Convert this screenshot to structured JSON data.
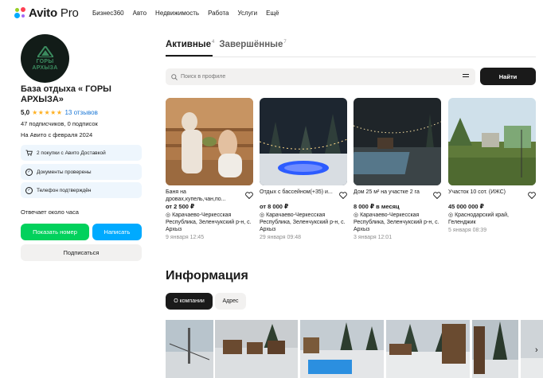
{
  "header": {
    "logo_text": "Avito",
    "logo_suffix": "Pro",
    "nav": [
      "Бизнес360",
      "Авто",
      "Недвижимость",
      "Работа",
      "Услуги",
      "Ещё"
    ]
  },
  "profile": {
    "avatar_text": "ГОРЫ\nАРХЫЗА",
    "name": "База отдыха « ГОРЫ АРХЫЗА»",
    "rating": "5,0",
    "stars": "★★★★★",
    "reviews": "13 отзывов",
    "subscribers": "47 подписчиков, 0 подписок",
    "since": "На Авито с февраля 2024",
    "badges": [
      "2 покупки с Авито Доставкой",
      "Документы проверены",
      "Телефон подтверждён"
    ],
    "reply_time": "Отвечает около часа",
    "show_number": "Показать номер",
    "write": "Написать",
    "subscribe": "Подписаться"
  },
  "tabs": {
    "active_label": "Активные",
    "active_count": "4",
    "done_label": "Завершённые",
    "done_count": "7"
  },
  "search": {
    "placeholder": "Поиск в профиле",
    "button": "Найти"
  },
  "listings": [
    {
      "title": "Баня на дровах,купель,чан,по...",
      "price": "от 2 500 ₽",
      "location": "Карачаево-Черкесская Республика, Зеленчукский р-н, с. Архыз",
      "date": "9 января 12:45"
    },
    {
      "title": "Отдых с бассейном(+35) и...",
      "price": "от 8 000 ₽",
      "location": "Карачаево-Черкесская Республика, Зеленчукский р-н, с. Архыз",
      "date": "29 января 09:48"
    },
    {
      "title": "Дом 25 м² на участке 2 га",
      "price": "8 000 ₽ в месяц",
      "location": "Карачаево-Черкесская Республика, Зеленчукский р-н, с. Архыз",
      "date": "3 января 12:01"
    },
    {
      "title": "Участок 10 сот. (ИЖС)",
      "price": "45 000 000 ₽",
      "location": "Краснодарский край, Геленджик",
      "date": "5 января 08:39"
    }
  ],
  "info": {
    "title": "Информация",
    "tab_about": "О компании",
    "tab_address": "Адрес"
  },
  "colors": {
    "green": "#02d15c",
    "blue": "#00aaff",
    "link": "#1a77d6",
    "star": "#ffb021",
    "dark": "#1a1a1a"
  },
  "icons": {
    "cart": "cart-icon",
    "check": "check-circle-icon",
    "heart": "heart-icon",
    "location": "location-pin-icon",
    "filter": "filter-icon",
    "search": "search-icon",
    "chevron": "chevron-right-icon"
  }
}
